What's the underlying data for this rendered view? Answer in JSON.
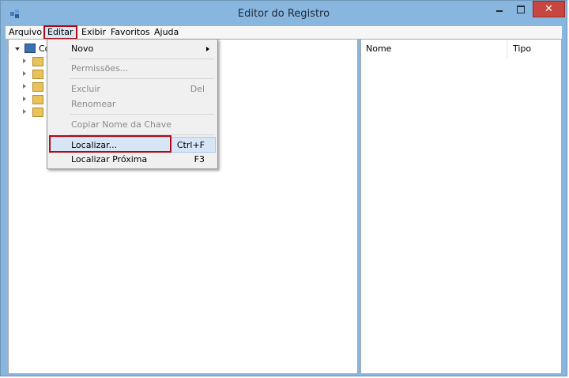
{
  "window": {
    "title": "Editor do Registro",
    "close_glyph": "✕"
  },
  "menubar": {
    "items": [
      {
        "label": "Arquivo"
      },
      {
        "label": "Editar"
      },
      {
        "label": "Exibir"
      },
      {
        "label": "Favoritos"
      },
      {
        "label": "Ajuda"
      }
    ]
  },
  "tree": {
    "root_label": "Co"
  },
  "list_view": {
    "columns": [
      "Nome",
      "Tipo"
    ]
  },
  "edit_menu": {
    "items": [
      {
        "label": "Novo",
        "shortcut": ""
      },
      {
        "label": "Permissões...",
        "shortcut": ""
      },
      {
        "label": "Excluir",
        "shortcut": "Del"
      },
      {
        "label": "Renomear",
        "shortcut": ""
      },
      {
        "label": "Copiar Nome da Chave",
        "shortcut": ""
      },
      {
        "label": "Localizar...",
        "shortcut": "Ctrl+F"
      },
      {
        "label": "Localizar Próxima",
        "shortcut": "F3"
      }
    ]
  },
  "colors": {
    "titlebar": "#89b6df",
    "highlight_outline": "#b00a16",
    "close_button": "#c7463f"
  },
  "icons": [
    "regedit-icon",
    "minimize-icon",
    "maximize-icon",
    "close-icon",
    "computer-icon",
    "folder-icon",
    "submenu-arrow-icon"
  ]
}
